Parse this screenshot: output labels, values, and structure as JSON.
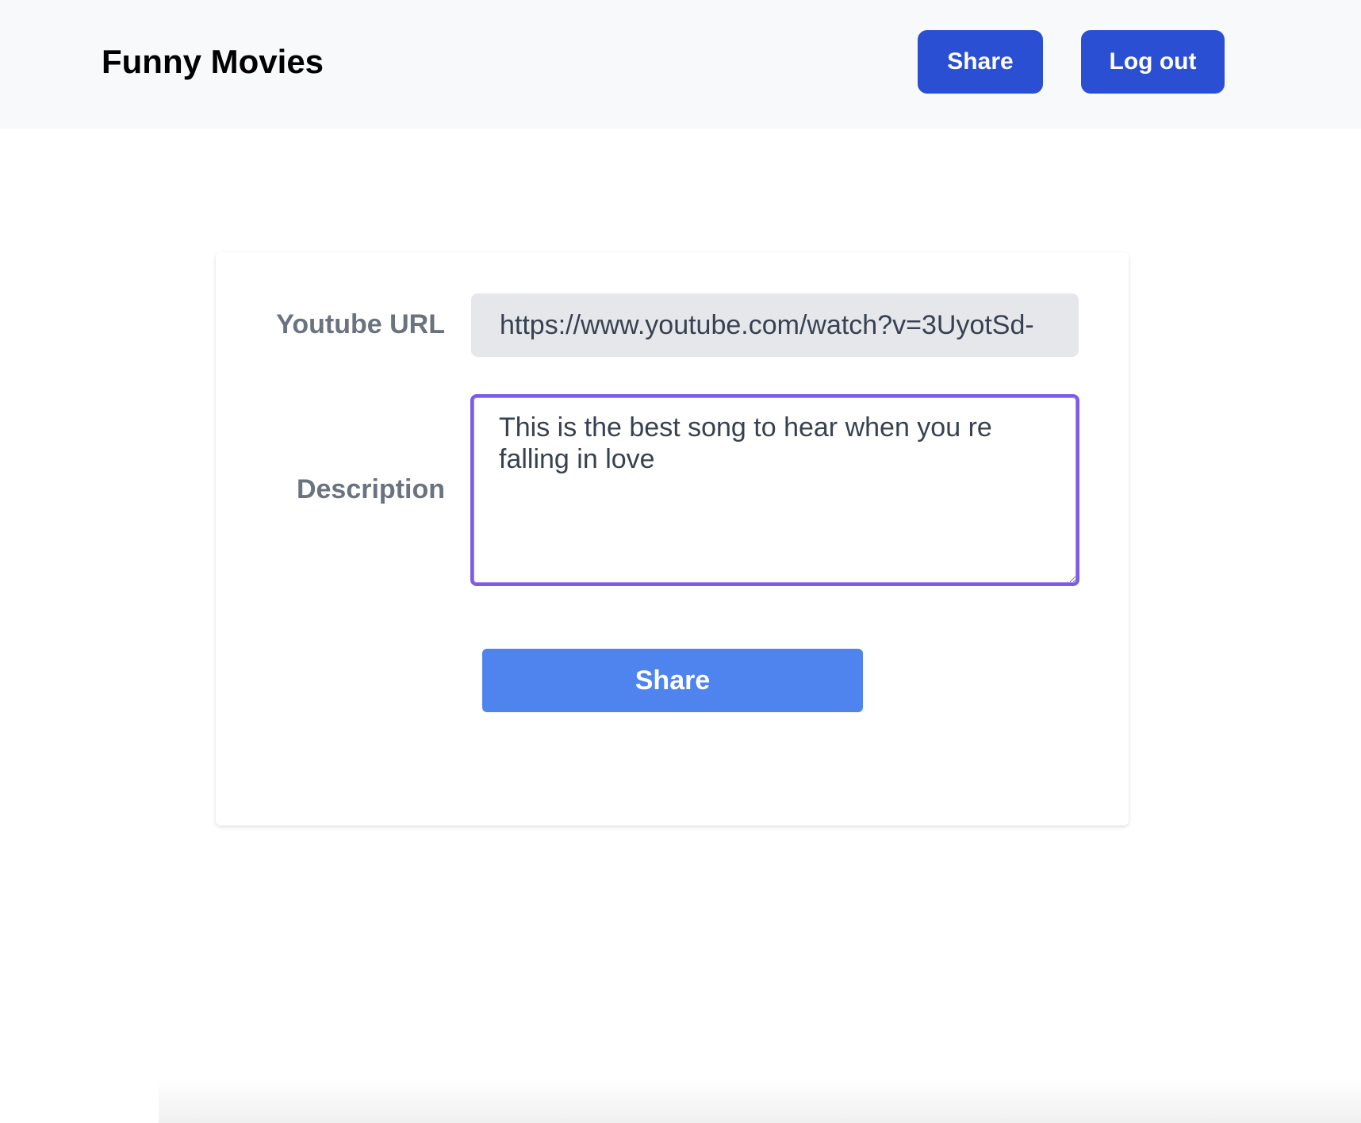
{
  "header": {
    "brand": "Funny Movies",
    "share_label": "Share",
    "logout_label": "Log out"
  },
  "form": {
    "url_label": "Youtube URL",
    "url_value": "https://www.youtube.com/watch?v=3UyotSd-",
    "description_label": "Description",
    "description_value": "This is the best song to hear when you re falling in love",
    "submit_label": "Share"
  },
  "colors": {
    "navbar_background": "#f8f9fa",
    "nav_button": "#2a4fd3",
    "submit_button": "#4f83ee",
    "label_text": "#6b7280",
    "url_input_background": "#e5e7eb",
    "focus_border": "#7c5ce6"
  }
}
